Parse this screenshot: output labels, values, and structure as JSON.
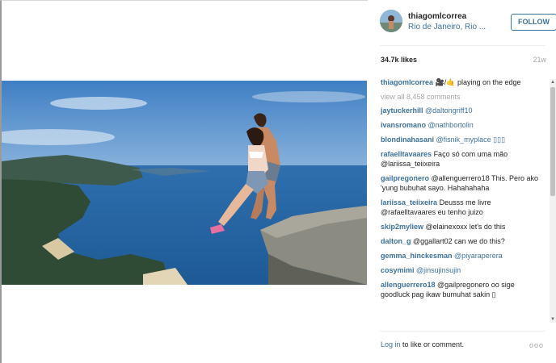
{
  "post": {
    "username": "thiagomlcorrea",
    "location": "Rio de Janeiro, Rio ...",
    "follow_label": "FOLLOW",
    "likes": "34.7k likes",
    "time_ago": "21w",
    "caption": {
      "user": "thiagomlcorrea",
      "text": " 🎥/🤙 playing on the edge"
    },
    "view_all": "view all 8,458 comments"
  },
  "comments": [
    {
      "user": "jaytuckerhill",
      "text": " @daltongriff10"
    },
    {
      "user": "ivansromano",
      "text": " @nathbortolin"
    },
    {
      "user": "blondinahasani",
      "text": " @fisnik_myplace ▯▯▯"
    },
    {
      "user": "rafaelltavaares",
      "text": " Faço só com uma mão @lariissa_teiixeira"
    },
    {
      "user": "gailpregonero",
      "text": " @allenguerrero18 This. Pero ako 'yung bubuhat sayo. Hahahahaha"
    },
    {
      "user": "lariissa_teiixeira",
      "text": " Deusss me livre @rafaelltavaares eu tenho juizo"
    },
    {
      "user": "skip2myliew",
      "text": " @elainexoxx let's do this"
    },
    {
      "user": "dalton_g",
      "text": " @ggallart02 can we do this?"
    },
    {
      "user": "gemma_hinckesman",
      "text": " @piyaraperera"
    },
    {
      "user": "cosymimi",
      "text": " @jinsujinsujin"
    },
    {
      "user": "allenguerrero18",
      "text": " @gailpregonero oo sige goodluck pag ikaw bumuhat sakin ▯"
    }
  ],
  "footer": {
    "login_label": "Log in",
    "login_suffix": " to like or comment.",
    "more_label": "ooo"
  },
  "colors": {
    "link": "#3f729b",
    "muted": "#a5a7aa",
    "text": "#262626"
  }
}
